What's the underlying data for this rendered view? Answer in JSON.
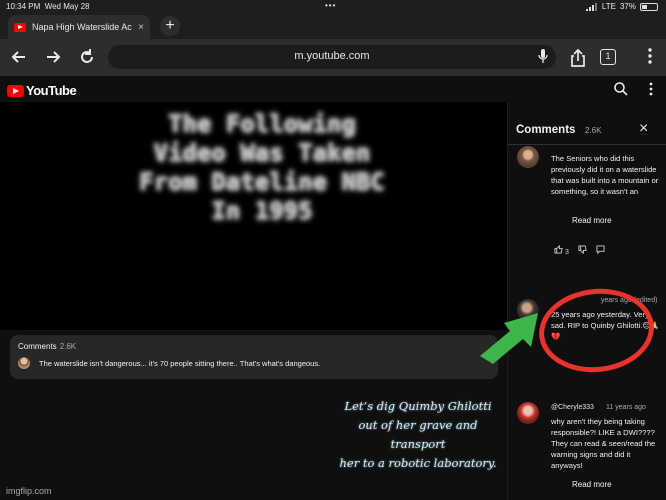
{
  "status_bar": {
    "time": "10:34 PM",
    "date": "Wed May 28",
    "network": "LTE",
    "battery": "37%",
    "battery_level": 0.37,
    "icons": [
      "signal-icon",
      "battery-icon"
    ]
  },
  "browser": {
    "tab_title": "Napa High Waterslide Ac",
    "tab_close": "×",
    "new_tab": "+",
    "url": "m.youtube.com",
    "tab_count": "1",
    "icons": [
      "back-icon",
      "forward-icon",
      "reload-icon",
      "mic-icon",
      "share-icon",
      "tabs-icon",
      "menu-icon"
    ]
  },
  "youtube": {
    "logo_text": "YouTube",
    "icons": [
      "search-icon",
      "more-icon"
    ]
  },
  "video": {
    "overlay_lines": [
      "The Following",
      "Video Was Taken",
      "From Dateline NBC",
      "In 1995"
    ]
  },
  "comments_teaser": {
    "label": "Comments",
    "count": "2.6K",
    "top_comment": "The waterslide isn't dangerous... it's 70 people sitting there.. That's what's dangeous."
  },
  "comments_panel": {
    "title": "Comments",
    "count": "2.6K",
    "close": "×",
    "comments": [
      {
        "text": "The Seniors who did this previously did it on a waterslide that was built into a mountain or something, so it wasn't an",
        "read_more": "Read more",
        "likes": "3"
      },
      {
        "meta": "years ago (edited)",
        "text": "25 years ago yesterday. Very sad. RIP to Quinby Ghilotti.😔🙏💔"
      },
      {
        "author": "@Cheryle333",
        "meta": "11 years ago",
        "text": "why aren't they being taking responsible?! LIKE a DWI???? They can read & seen/read the warning signs and did it anyways!",
        "read_more": "Read more"
      }
    ]
  },
  "meme": {
    "caption_lines": [
      "Let’s dig Quimby Ghilotti",
      "out of her grave and transport",
      "her to a robotic laboratory."
    ],
    "watermark": "imgflip.com",
    "ring_color": "#e8332c",
    "arrow_color": "#3cb54a"
  }
}
